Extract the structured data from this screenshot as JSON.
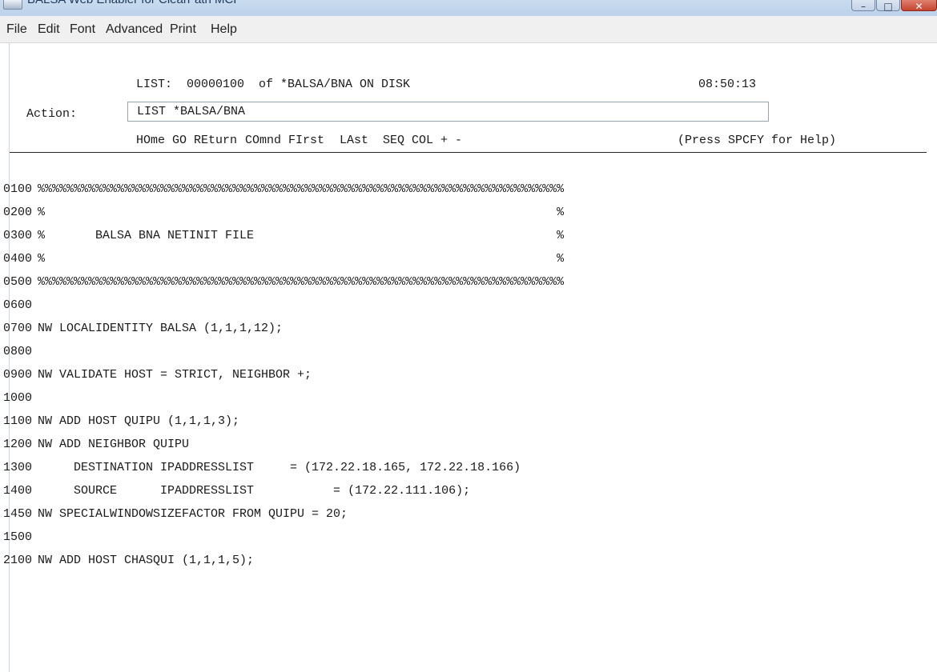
{
  "window": {
    "title": "BALSA Web Enabler for Clearr ath MCP"
  },
  "menu": [
    "File",
    "Edit",
    "Font",
    "Advanced",
    "Print",
    "Help"
  ],
  "header": {
    "list_line": "LIST:  00000100  of *BALSA/BNA ON DISK",
    "time": "08:50:13",
    "action_label": "Action:",
    "action_value": "LIST *BALSA/BNA",
    "commands": [
      "HOme",
      "GO",
      "REturn",
      "COmnd",
      "FIrst",
      "LAst",
      "SEQ",
      "COL",
      "+",
      "-"
    ],
    "help": "(Press SPCFY for Help)"
  },
  "listing": [
    {
      "num": "0100",
      "text": "%%%%%%%%%%%%%%%%%%%%%%%%%%%%%%%%%%%%%%%%%%%%%%%%%%%%%%%%%%%%%%%%%%%%%%%%%"
    },
    {
      "num": "0200",
      "text": "%                                                                       %"
    },
    {
      "num": "0300",
      "text": "%       BALSA BNA NETINIT FILE                                          %"
    },
    {
      "num": "0400",
      "text": "%                                                                       %"
    },
    {
      "num": "0500",
      "text": "%%%%%%%%%%%%%%%%%%%%%%%%%%%%%%%%%%%%%%%%%%%%%%%%%%%%%%%%%%%%%%%%%%%%%%%%%"
    },
    {
      "num": "0600",
      "text": ""
    },
    {
      "num": "0700",
      "text": "NW LOCALIDENTITY BALSA (1,1,1,12);"
    },
    {
      "num": "0800",
      "text": ""
    },
    {
      "num": "0900",
      "text": "NW VALIDATE HOST = STRICT, NEIGHBOR +;"
    },
    {
      "num": "1000",
      "text": ""
    },
    {
      "num": "1100",
      "text": "NW ADD HOST QUIPU (1,1,1,3);"
    },
    {
      "num": "1200",
      "text": "NW ADD NEIGHBOR QUIPU"
    },
    {
      "num": "1300",
      "text": "     DESTINATION IPADDRESSLIST     = (172.22.18.165, 172.22.18.166)"
    },
    {
      "num": "1400",
      "text": "     SOURCE      IPADDRESSLIST           = (172.22.111.106);"
    },
    {
      "num": "1450",
      "text": "NW SPECIALWINDOWSIZEFACTOR FROM QUIPU = 20;"
    },
    {
      "num": "1500",
      "text": ""
    },
    {
      "num": "2100",
      "text": "NW ADD HOST CHASQUI (1,1,1,5);"
    }
  ]
}
